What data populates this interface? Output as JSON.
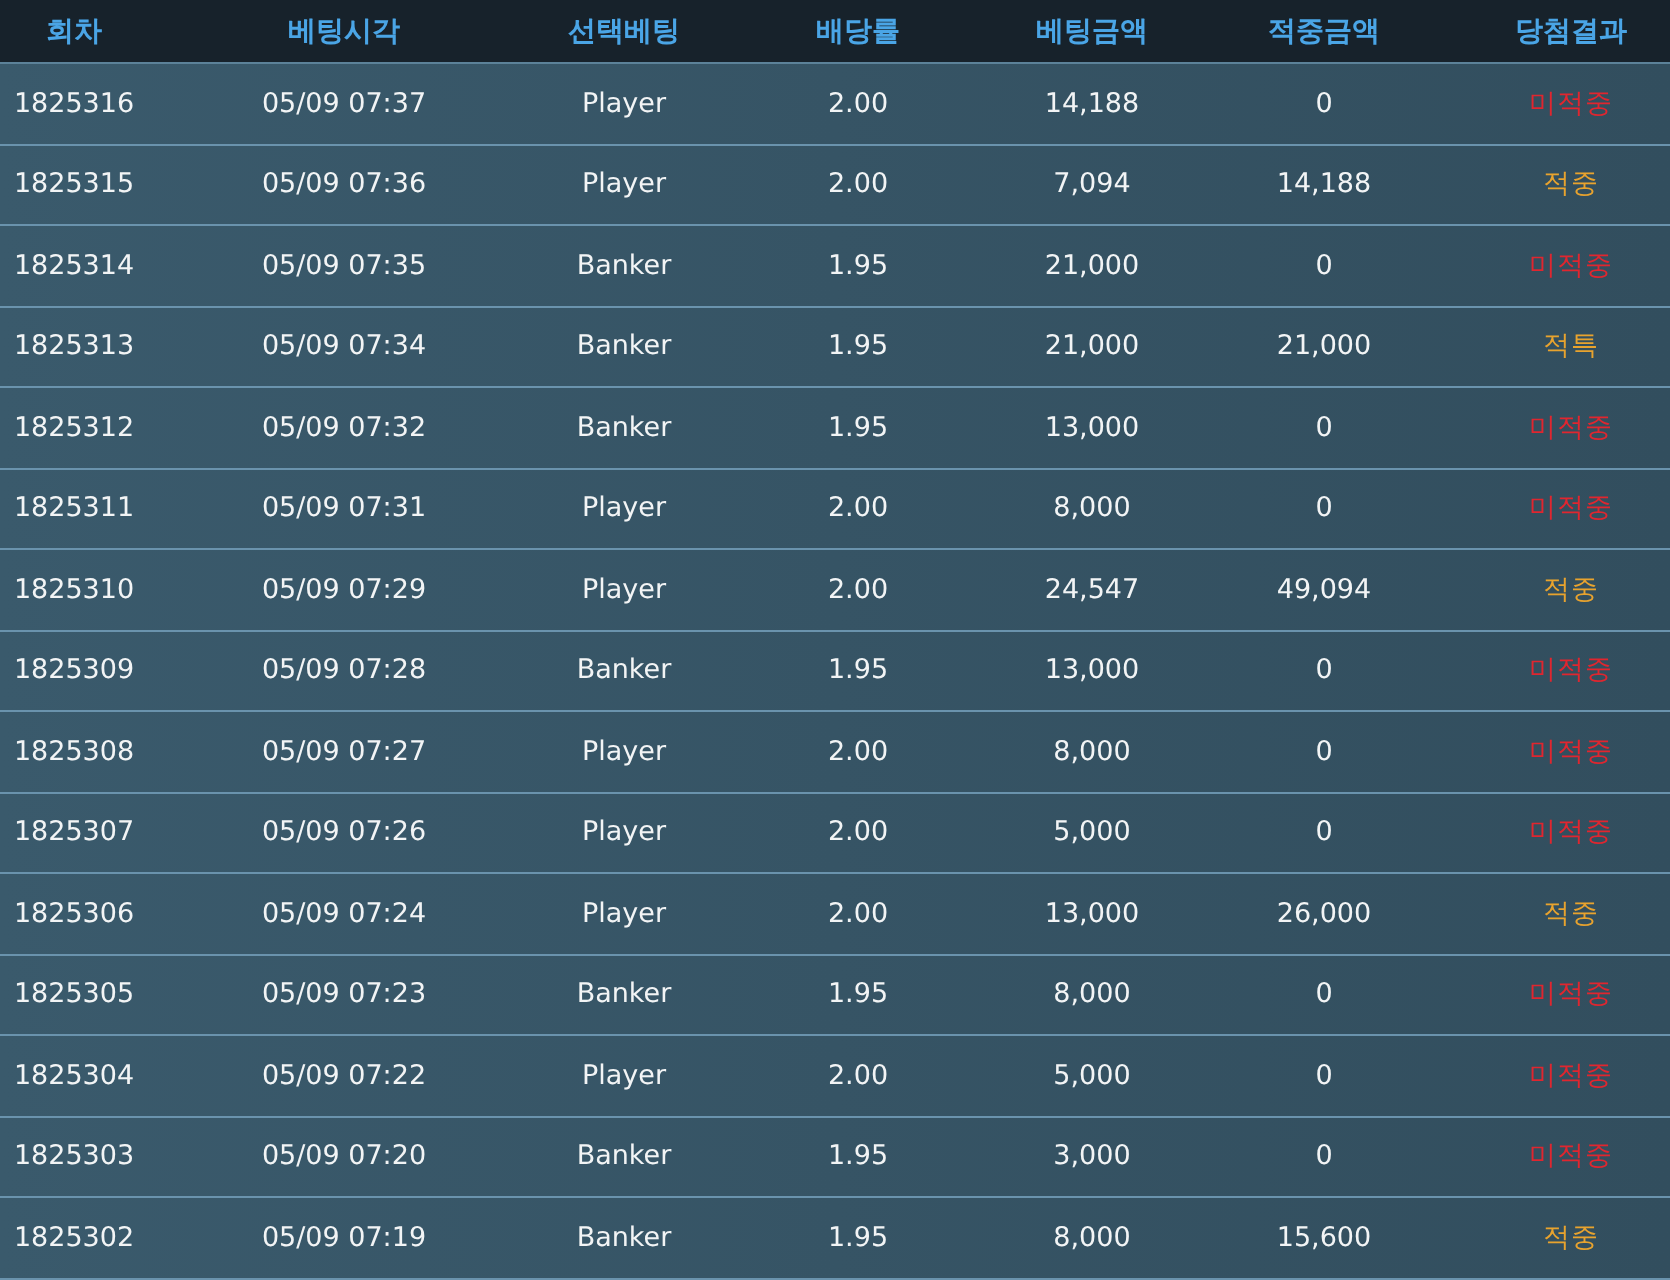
{
  "table": {
    "columns": [
      "회차",
      "베팅시각",
      "선택베팅",
      "배당률",
      "베팅금액",
      "적중금액",
      "당첨결과"
    ],
    "rows": [
      {
        "round": "1825316",
        "time": "05/09 07:37",
        "pick": "Player",
        "odds": "2.00",
        "bet": "14,188",
        "win": "0",
        "result": "미적중",
        "color": "#e0262f"
      },
      {
        "round": "1825315",
        "time": "05/09 07:36",
        "pick": "Player",
        "odds": "2.00",
        "bet": "7,094",
        "win": "14,188",
        "result": "적중",
        "color": "#e8a32e"
      },
      {
        "round": "1825314",
        "time": "05/09 07:35",
        "pick": "Banker",
        "odds": "1.95",
        "bet": "21,000",
        "win": "0",
        "result": "미적중",
        "color": "#e0262f"
      },
      {
        "round": "1825313",
        "time": "05/09 07:34",
        "pick": "Banker",
        "odds": "1.95",
        "bet": "21,000",
        "win": "21,000",
        "result": "적특",
        "color": "#e8a32e"
      },
      {
        "round": "1825312",
        "time": "05/09 07:32",
        "pick": "Banker",
        "odds": "1.95",
        "bet": "13,000",
        "win": "0",
        "result": "미적중",
        "color": "#e0262f"
      },
      {
        "round": "1825311",
        "time": "05/09 07:31",
        "pick": "Player",
        "odds": "2.00",
        "bet": "8,000",
        "win": "0",
        "result": "미적중",
        "color": "#e0262f"
      },
      {
        "round": "1825310",
        "time": "05/09 07:29",
        "pick": "Player",
        "odds": "2.00",
        "bet": "24,547",
        "win": "49,094",
        "result": "적중",
        "color": "#e8a32e"
      },
      {
        "round": "1825309",
        "time": "05/09 07:28",
        "pick": "Banker",
        "odds": "1.95",
        "bet": "13,000",
        "win": "0",
        "result": "미적중",
        "color": "#e0262f"
      },
      {
        "round": "1825308",
        "time": "05/09 07:27",
        "pick": "Player",
        "odds": "2.00",
        "bet": "8,000",
        "win": "0",
        "result": "미적중",
        "color": "#e0262f"
      },
      {
        "round": "1825307",
        "time": "05/09 07:26",
        "pick": "Player",
        "odds": "2.00",
        "bet": "5,000",
        "win": "0",
        "result": "미적중",
        "color": "#e0262f"
      },
      {
        "round": "1825306",
        "time": "05/09 07:24",
        "pick": "Player",
        "odds": "2.00",
        "bet": "13,000",
        "win": "26,000",
        "result": "적중",
        "color": "#e8a32e"
      },
      {
        "round": "1825305",
        "time": "05/09 07:23",
        "pick": "Banker",
        "odds": "1.95",
        "bet": "8,000",
        "win": "0",
        "result": "미적중",
        "color": "#e0262f"
      },
      {
        "round": "1825304",
        "time": "05/09 07:22",
        "pick": "Player",
        "odds": "2.00",
        "bet": "5,000",
        "win": "0",
        "result": "미적중",
        "color": "#e0262f"
      },
      {
        "round": "1825303",
        "time": "05/09 07:20",
        "pick": "Banker",
        "odds": "1.95",
        "bet": "3,000",
        "win": "0",
        "result": "미적중",
        "color": "#e0262f"
      },
      {
        "round": "1825302",
        "time": "05/09 07:19",
        "pick": "Banker",
        "odds": "1.95",
        "bet": "8,000",
        "win": "15,600",
        "result": "적중",
        "color": "#e8a32e"
      }
    ]
  }
}
